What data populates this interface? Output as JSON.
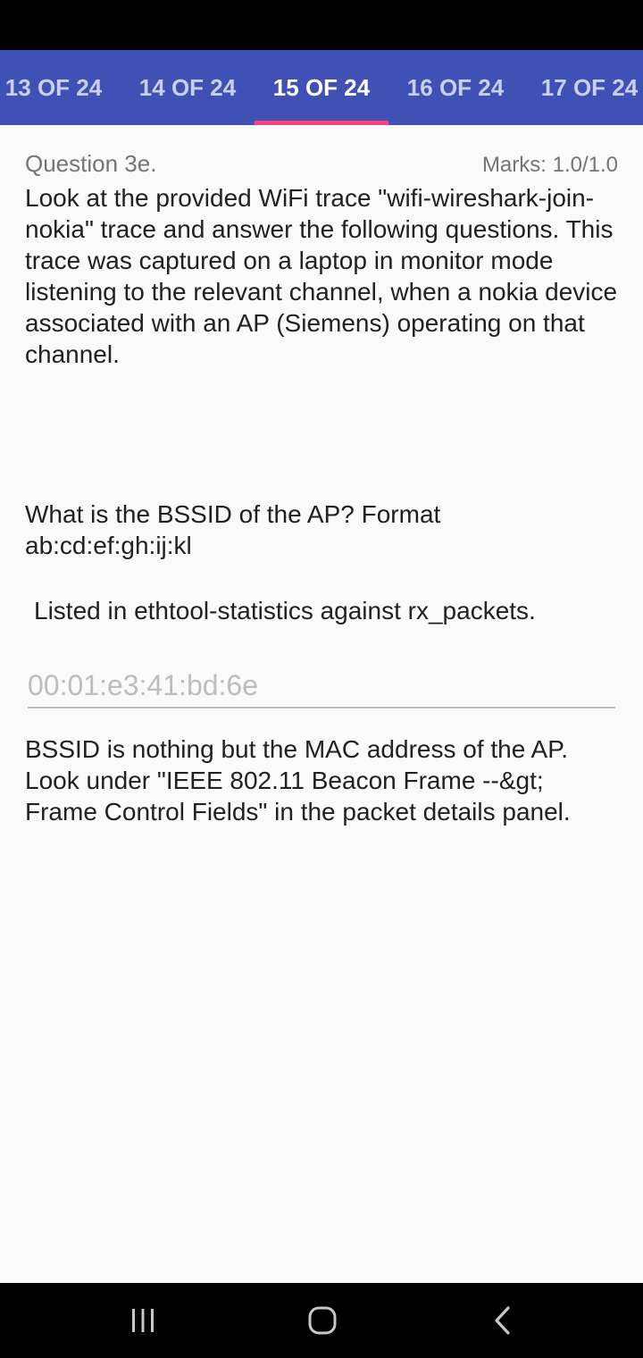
{
  "tabs": [
    {
      "label": "13 OF 24",
      "active": false
    },
    {
      "label": "14 OF 24",
      "active": false
    },
    {
      "label": "15 OF 24",
      "active": true
    },
    {
      "label": "16 OF 24",
      "active": false
    },
    {
      "label": "17 OF 24",
      "active": false
    }
  ],
  "question": {
    "number": "Question 3e.",
    "marks": "Marks: 1.0/1.0",
    "text": "Look at the provided WiFi trace \"wifi-wireshark-join-nokia\" trace and answer the following questions. This trace was captured on a laptop in monitor mode listening to the relevant channel, when a nokia device associated with an AP (Siemens) operating on that channel.",
    "sub_question": "What is the BSSID of the AP? Format ab:cd:ef:gh:ij:kl",
    "hint": "Listed in ethtool-statistics against rx_packets.",
    "answer_value": "00:01:e3:41:bd:6e",
    "feedback": "BSSID is nothing but the MAC address of the AP. Look under \"IEEE 802.11 Beacon Frame --&gt; Frame Control Fields\" in the packet details panel."
  },
  "colors": {
    "tab_bar": "#3f51b5",
    "indicator": "#ff4081",
    "background": "#fafafa",
    "system_bars": "#000000"
  },
  "icons": {
    "recents": "recent-apps-icon",
    "home": "home-icon",
    "back": "back-icon"
  }
}
